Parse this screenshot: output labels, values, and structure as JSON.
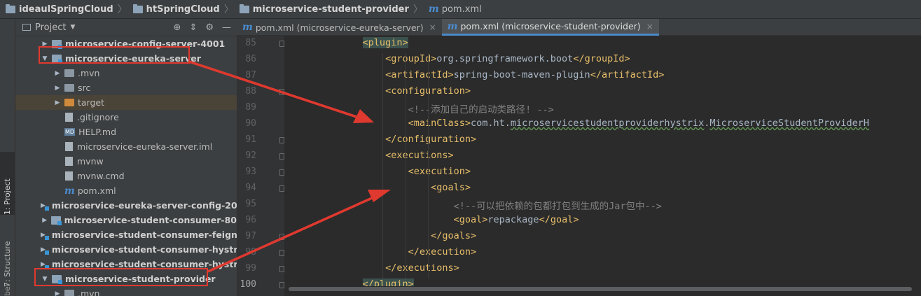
{
  "breadcrumb": [
    {
      "label": "ideaulSpringCloud",
      "icon": "folder-icon"
    },
    {
      "label": "htSpringCloud",
      "icon": "folder-icon"
    },
    {
      "label": "microservice-student-provider",
      "icon": "folder-icon"
    },
    {
      "label": "pom.xml",
      "icon": "maven-icon"
    }
  ],
  "toolstrip": {
    "project_tab": "1: Project",
    "structure_tab": "7: Structure",
    "bottom_tab": "bel"
  },
  "project_panel": {
    "title": "Project",
    "tree": [
      {
        "label": "microservice-config-server-4001",
        "kind": "module",
        "arrow": "▶",
        "bold": true
      },
      {
        "label": "microservice-eureka-server",
        "kind": "module",
        "arrow": "▼",
        "bold": true
      },
      {
        "label": ".mvn",
        "kind": "folder",
        "arrow": "▶"
      },
      {
        "label": "src",
        "kind": "folder",
        "arrow": "▶"
      },
      {
        "label": "target",
        "kind": "folder-orange",
        "arrow": "▶"
      },
      {
        "label": ".gitignore",
        "kind": "file",
        "arrow": ""
      },
      {
        "label": "HELP.md",
        "kind": "md",
        "arrow": ""
      },
      {
        "label": "microservice-eureka-server.iml",
        "kind": "file",
        "arrow": ""
      },
      {
        "label": "mvnw",
        "kind": "file",
        "arrow": ""
      },
      {
        "label": "mvnw.cmd",
        "kind": "file",
        "arrow": ""
      },
      {
        "label": "pom.xml",
        "kind": "maven",
        "arrow": ""
      },
      {
        "label": "microservice-eureka-server-config-2004",
        "kind": "module",
        "arrow": "▶",
        "bold": true
      },
      {
        "label": "microservice-student-consumer-80",
        "kind": "module",
        "arrow": "▶",
        "bold": true
      },
      {
        "label": "microservice-student-consumer-feign-8",
        "kind": "module",
        "arrow": "▶",
        "bold": true
      },
      {
        "label": "microservice-student-consumer-hystrix",
        "kind": "module",
        "arrow": "▶",
        "bold": true
      },
      {
        "label": "microservice-student-consumer-hystrix",
        "kind": "module",
        "arrow": "▶",
        "bold": true
      },
      {
        "label": "microservice-student-provider",
        "kind": "module",
        "arrow": "▼",
        "bold": true
      },
      {
        "label": ".mvn",
        "kind": "folder",
        "arrow": "▶"
      }
    ]
  },
  "editor": {
    "tabs": [
      {
        "label": "pom.xml (microservice-eureka-server)",
        "active": false
      },
      {
        "label": "pom.xml (microservice-student-provider)",
        "active": true
      }
    ],
    "lines": [
      {
        "n": "85",
        "indent": 3,
        "parts": [
          {
            "t": "<plugin>",
            "c": "tag hl-tag"
          }
        ]
      },
      {
        "n": "86",
        "indent": 4,
        "parts": [
          {
            "t": "<groupId>",
            "c": "tag"
          },
          {
            "t": "org.springframework.boot",
            "c": ""
          },
          {
            "t": "</groupId>",
            "c": "tag"
          }
        ]
      },
      {
        "n": "87",
        "indent": 4,
        "parts": [
          {
            "t": "<artifactId>",
            "c": "tag"
          },
          {
            "t": "spring-boot-maven-plugin",
            "c": ""
          },
          {
            "t": "</artifactId>",
            "c": "tag"
          }
        ]
      },
      {
        "n": "88",
        "indent": 4,
        "parts": [
          {
            "t": "<configuration>",
            "c": "tag"
          }
        ]
      },
      {
        "n": "89",
        "indent": 5,
        "parts": [
          {
            "t": "<!--添加自己的启动类路径! -->",
            "c": "cmt"
          }
        ]
      },
      {
        "n": "90",
        "indent": 5,
        "parts": [
          {
            "t": "<mainClass>",
            "c": "tag"
          },
          {
            "t": "com.ht.",
            "c": ""
          },
          {
            "t": "microservicestudentproviderhystrix",
            "c": "squig"
          },
          {
            "t": ".",
            "c": ""
          },
          {
            "t": "MicroserviceStudentProviderH",
            "c": "squig"
          }
        ]
      },
      {
        "n": "91",
        "indent": 4,
        "parts": [
          {
            "t": "</configuration>",
            "c": "tag"
          }
        ]
      },
      {
        "n": "92",
        "indent": 4,
        "parts": [
          {
            "t": "<executions>",
            "c": "tag"
          }
        ]
      },
      {
        "n": "93",
        "indent": 5,
        "parts": [
          {
            "t": "<execution>",
            "c": "tag"
          }
        ]
      },
      {
        "n": "94",
        "indent": 6,
        "parts": [
          {
            "t": "<goals>",
            "c": "tag"
          }
        ]
      },
      {
        "n": "95",
        "indent": 7,
        "parts": [
          {
            "t": "<!--可以把依赖的包都打包到生成的Jar包中-->",
            "c": "cmt"
          }
        ]
      },
      {
        "n": "96",
        "indent": 7,
        "parts": [
          {
            "t": "<goal>",
            "c": "tag"
          },
          {
            "t": "repackage",
            "c": ""
          },
          {
            "t": "</goal>",
            "c": "tag"
          }
        ]
      },
      {
        "n": "97",
        "indent": 6,
        "parts": [
          {
            "t": "</goals>",
            "c": "tag"
          }
        ]
      },
      {
        "n": "98",
        "indent": 5,
        "parts": [
          {
            "t": "</execution>",
            "c": "tag"
          }
        ]
      },
      {
        "n": "99",
        "indent": 4,
        "parts": [
          {
            "t": "</executions>",
            "c": "tag"
          }
        ]
      },
      {
        "n": "100",
        "indent": 3,
        "parts": [
          {
            "t": "</plugin>",
            "c": "tag hl-tag"
          }
        ]
      }
    ]
  },
  "colors": {
    "annotation_red": "#e0392f",
    "tag": "#e8bf6a",
    "comment": "#808080",
    "text": "#a9b7c6",
    "active_tab_underline": "#4a88c7"
  }
}
